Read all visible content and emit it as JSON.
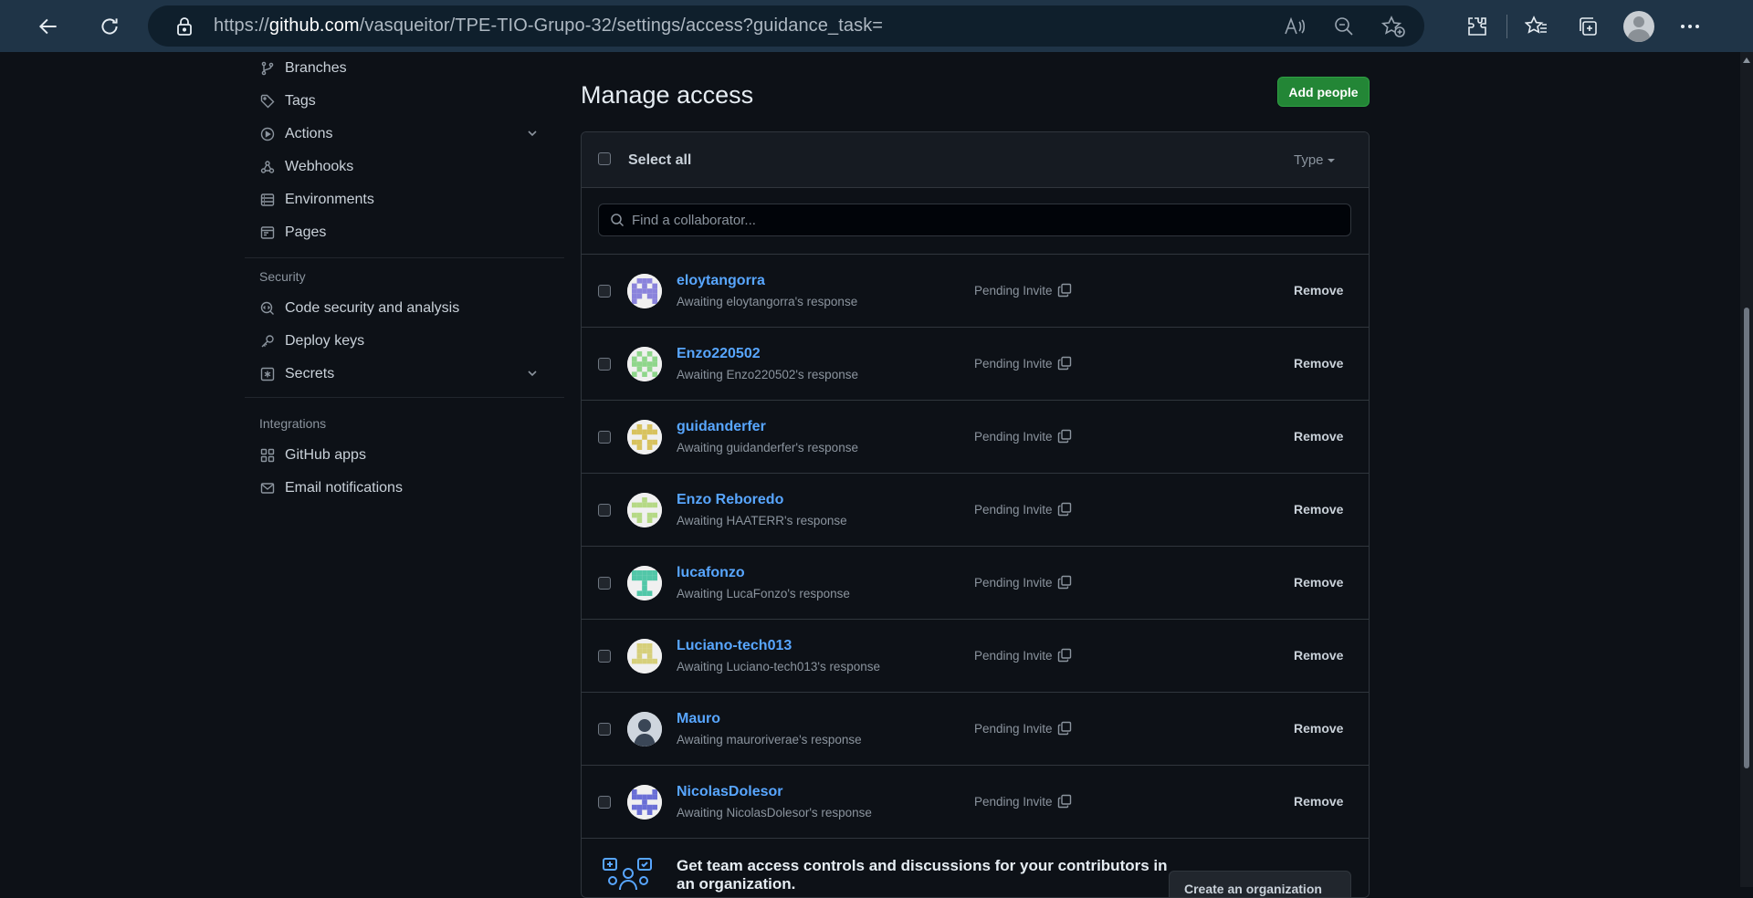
{
  "browser": {
    "url_prefix": "https://",
    "url_host": "github.com",
    "url_path": "/vasqueitor/TPE-TIO-Grupo-32/settings/access?guidance_task="
  },
  "sidebar": {
    "top_items": [
      {
        "label": "Branches",
        "icon": "git-branch-icon"
      },
      {
        "label": "Tags",
        "icon": "tag-icon"
      },
      {
        "label": "Actions",
        "icon": "play-circle-icon",
        "expandable": true
      },
      {
        "label": "Webhooks",
        "icon": "webhook-icon"
      },
      {
        "label": "Environments",
        "icon": "server-icon"
      },
      {
        "label": "Pages",
        "icon": "browser-icon"
      }
    ],
    "security_heading": "Security",
    "security_items": [
      {
        "label": "Code security and analysis",
        "icon": "codescan-icon"
      },
      {
        "label": "Deploy keys",
        "icon": "key-icon"
      },
      {
        "label": "Secrets",
        "icon": "asterisk-icon",
        "expandable": true
      }
    ],
    "integrations_heading": "Integrations",
    "integration_items": [
      {
        "label": "GitHub apps",
        "icon": "apps-icon"
      },
      {
        "label": "Email notifications",
        "icon": "mail-icon"
      }
    ]
  },
  "main": {
    "title": "Manage access",
    "add_button": "Add people",
    "select_all": "Select all",
    "type_filter": "Type",
    "search_placeholder": "Find a collaborator...",
    "pending_label": "Pending Invite",
    "remove_label": "Remove",
    "collaborators": [
      {
        "username": "eloytangorra",
        "status": "Awaiting eloytangorra's response",
        "avatar_color": "#8a83dc"
      },
      {
        "username": "Enzo220502",
        "status": "Awaiting Enzo220502's response",
        "avatar_color": "#8fd68b"
      },
      {
        "username": "guidanderfer",
        "status": "Awaiting guidanderfer's response",
        "avatar_color": "#d8c25e"
      },
      {
        "username": "Enzo Reboredo",
        "status": "Awaiting HAATERR's response",
        "avatar_color": "#b5d985"
      },
      {
        "username": "lucafonzo",
        "status": "Awaiting LucaFonzo's response",
        "avatar_color": "#52c7a8"
      },
      {
        "username": "Luciano-tech013",
        "status": "Awaiting Luciano-tech013's response",
        "avatar_color": "#d6cf7a"
      },
      {
        "username": "Mauro",
        "status": "Awaiting mauroriverae's response",
        "avatar_color": "#3a4656"
      },
      {
        "username": "NicolasDolesor",
        "status": "Awaiting NicolasDolesor's response",
        "avatar_color": "#6a6fd6"
      }
    ],
    "promo_text": "Get team access controls and discussions for your contributors in an organization.",
    "promo_button": "Create an organization"
  }
}
